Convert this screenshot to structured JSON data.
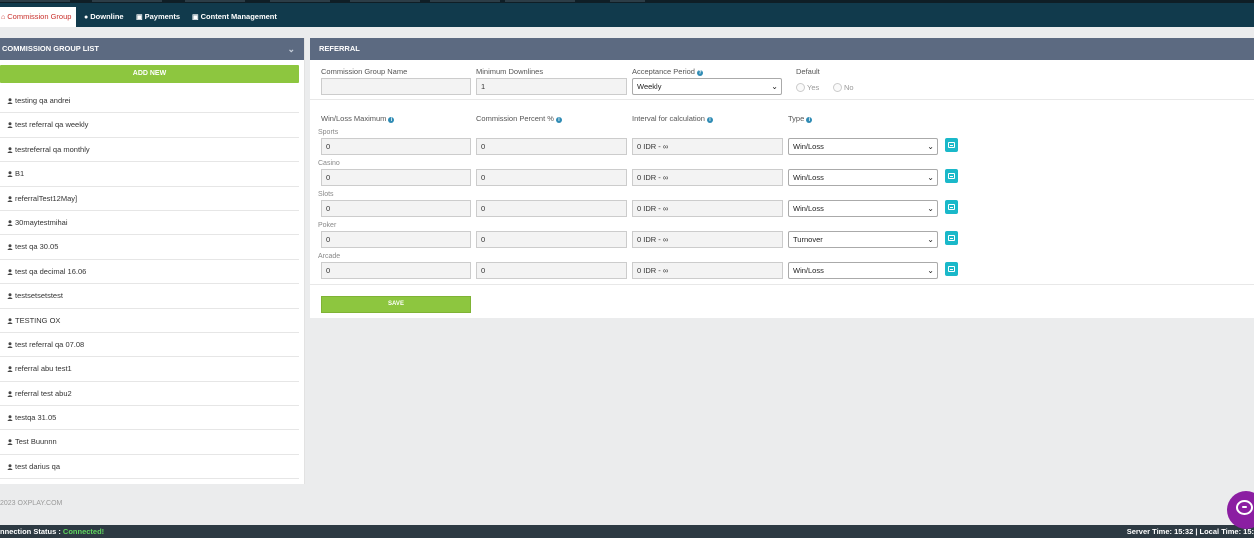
{
  "nav": {
    "tabs": [
      {
        "label": "Commission Group",
        "icon": "home-icon"
      },
      {
        "label": "Downline",
        "icon": "user-icon"
      },
      {
        "label": "Payments",
        "icon": "money-icon"
      },
      {
        "label": "Content Management",
        "icon": "money-icon"
      }
    ]
  },
  "left": {
    "title": "COMMISSION GROUP LIST",
    "add_label": "ADD NEW",
    "groups": [
      "testing qa andrei",
      "test referral qa weekly",
      "testreferral qa monthly",
      "B1",
      "referralTest12May]",
      "30maytestmihai",
      "test qa 30.05",
      "test qa decimal 16.06",
      "testsetsetstest",
      "TESTING OX",
      "test referral qa 07.08",
      "referral abu test1",
      "referral test abu2",
      "testqa 31.05",
      "Test Buunnn",
      "test darius qa"
    ]
  },
  "form": {
    "title": "REFERRAL",
    "labels": {
      "group_name": "Commission Group Name",
      "min_downlines": "Minimum Downlines",
      "acceptance_period": "Acceptance Period",
      "default": "Default",
      "winloss_max": "Win/Loss Maximum",
      "commission_percent": "Commission Percent %",
      "interval": "Interval for calculation",
      "type": "Type"
    },
    "values": {
      "group_name": "",
      "min_downlines": "1",
      "acceptance_period": "Weekly",
      "default_yes": "Yes",
      "default_no": "No"
    },
    "rows": [
      {
        "category": "Sports",
        "winloss": "0",
        "percent": "0",
        "interval": "0 IDR - ∞",
        "type": "Win/Loss"
      },
      {
        "category": "Casino",
        "winloss": "0",
        "percent": "0",
        "interval": "0 IDR - ∞",
        "type": "Win/Loss"
      },
      {
        "category": "Slots",
        "winloss": "0",
        "percent": "0",
        "interval": "0 IDR - ∞",
        "type": "Win/Loss"
      },
      {
        "category": "Poker",
        "winloss": "0",
        "percent": "0",
        "interval": "0 IDR - ∞",
        "type": "Turnover"
      },
      {
        "category": "Arcade",
        "winloss": "0",
        "percent": "0",
        "interval": "0 IDR - ∞",
        "type": "Win/Loss"
      }
    ],
    "save_label": "SAVE"
  },
  "footer": {
    "copyright": "2023 OXPLAY.COM",
    "connection_label": "nnection Status : ",
    "connection_value": "Connected!",
    "time_text": "Server Time: 15:32  |  Local Time: 15:"
  },
  "colors": {
    "navbar": "#113a4c",
    "panel_header": "#5c6a81",
    "green_button": "#8dc63f",
    "teal_button": "#1ab8c9",
    "active_tab_text": "#c9302c"
  }
}
